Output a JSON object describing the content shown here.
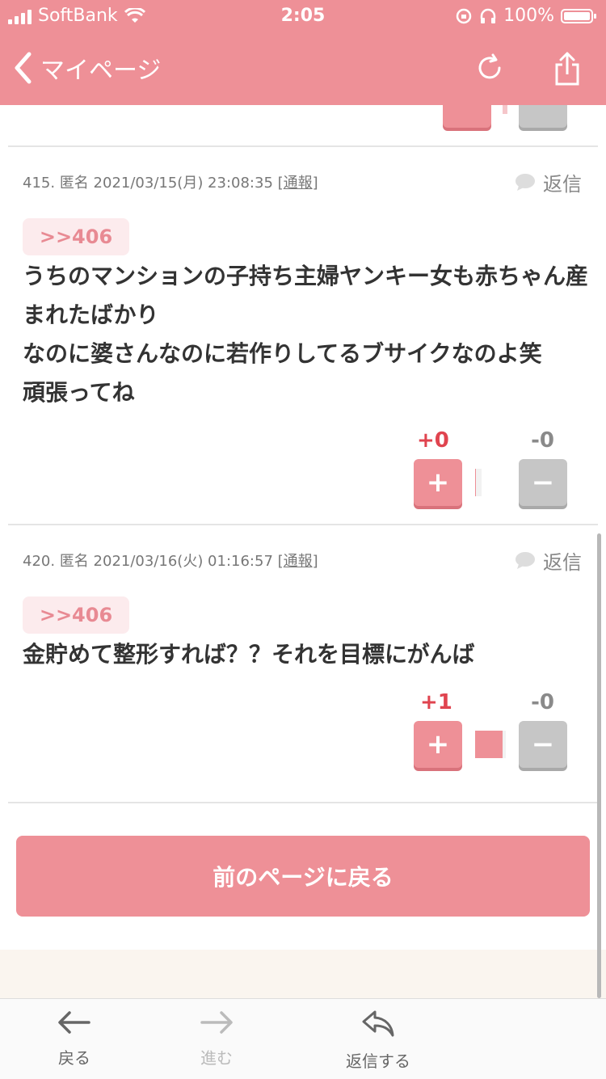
{
  "status_bar": {
    "carrier": "SoftBank",
    "time": "2:05",
    "battery": "100%"
  },
  "nav": {
    "title": "マイページ",
    "back_icon": "chevron-left-icon",
    "reload_icon": "reload-icon",
    "share_icon": "share-icon"
  },
  "posts": [
    {
      "number": "415.",
      "author": "匿名",
      "datetime": "2021/03/15(月) 23:08:35",
      "report_open": "[",
      "report_label": "通報",
      "report_close": "]",
      "reply_label": "返信",
      "anchor": ">>406",
      "text": "うちのマンションの子持ち主婦ヤンキー女も赤ちゃん産まれたばかり\nなのに婆さんなのに若作りしてるブサイクなのよ笑\n頑張ってね",
      "plus_count": "+0",
      "minus_count": "-0",
      "plus_symbol": "+",
      "minus_symbol": "−",
      "vote_ratio": 0.04
    },
    {
      "number": "420.",
      "author": "匿名",
      "datetime": "2021/03/16(火) 01:16:57",
      "report_open": "[",
      "report_label": "通報",
      "report_close": "]",
      "reply_label": "返信",
      "anchor": ">>406",
      "text": "金貯めて整形すれば？？それを目標にがんば",
      "plus_count": "+1",
      "minus_count": "-0",
      "plus_symbol": "+",
      "minus_symbol": "−",
      "vote_ratio": 0.9
    }
  ],
  "prev_page_button": "前のページに戻る",
  "toolbar": {
    "back": "戻る",
    "forward": "進む",
    "reply": "返信する"
  },
  "colors": {
    "accent": "#ee9097",
    "plus_count": "#e0444f",
    "minus_button": "#c6c6c6",
    "anchor_bg": "#fcebed"
  }
}
